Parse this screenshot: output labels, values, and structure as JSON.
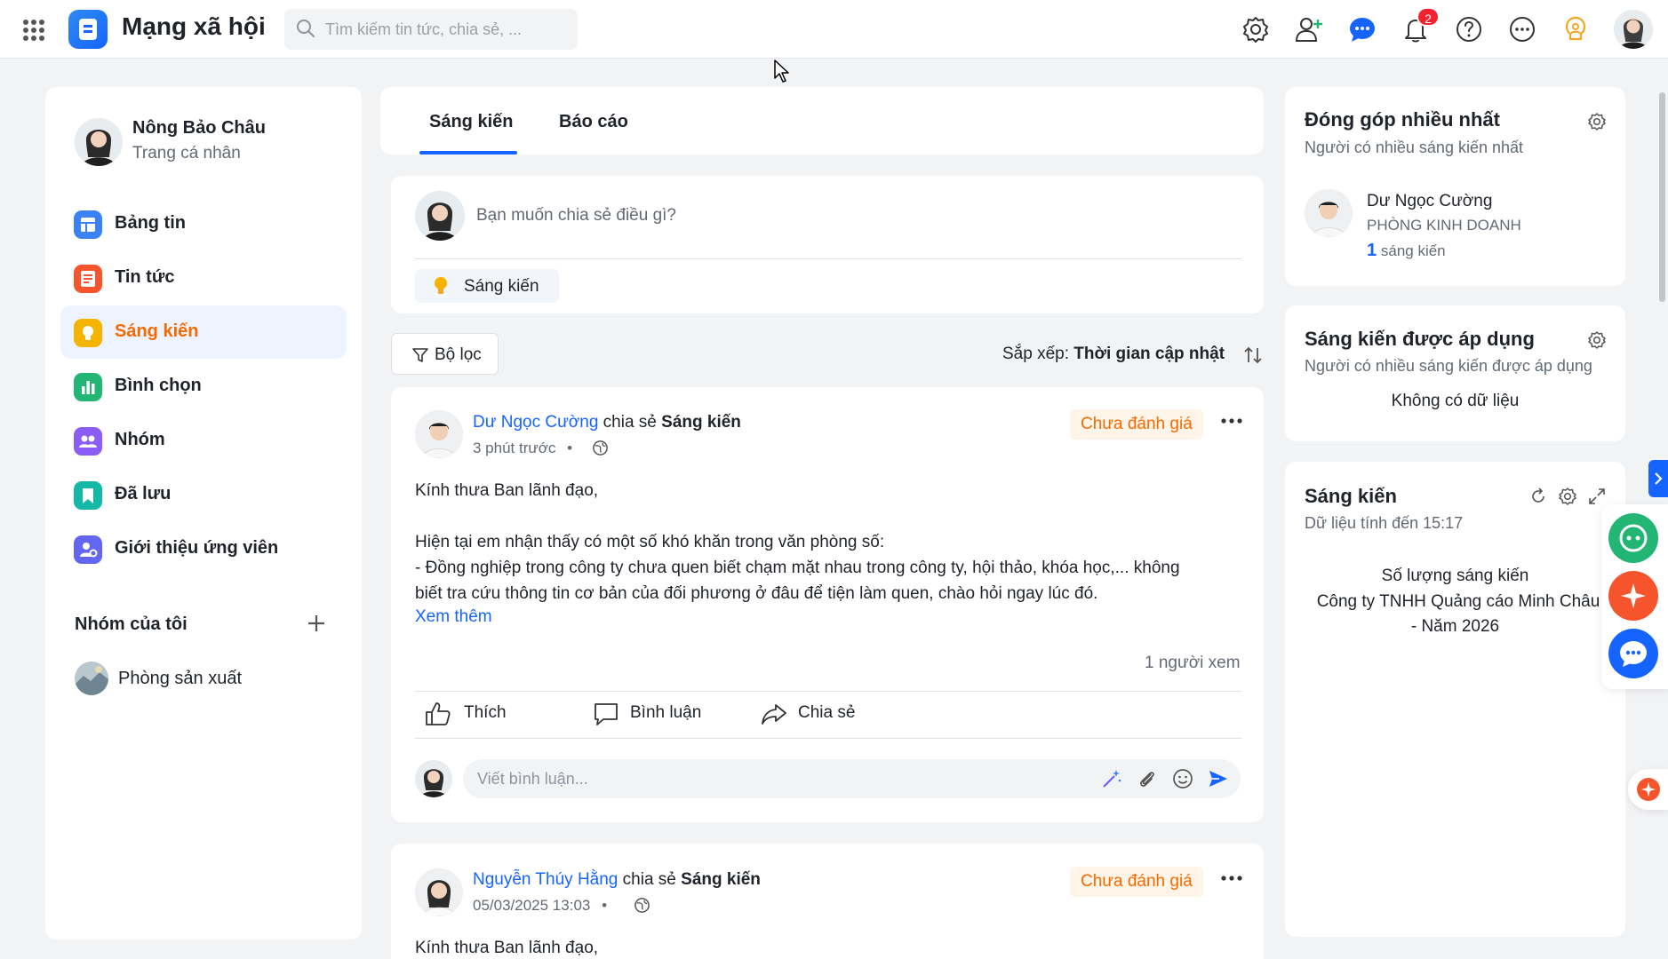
{
  "header": {
    "app_title": "Mạng xã hội",
    "search_placeholder": "Tìm kiếm tin tức, chia sẻ, ...",
    "notification_count": "2"
  },
  "sidebar": {
    "profile_name": "Nông Bảo Châu",
    "profile_sub": "Trang cá nhân",
    "items": [
      {
        "label": "Bảng tin",
        "color": "#3b82f6"
      },
      {
        "label": "Tin tức",
        "color": "#f5542d"
      },
      {
        "label": "Sáng kiến",
        "color": "#f5b400"
      },
      {
        "label": "Bình chọn",
        "color": "#22b573"
      },
      {
        "label": "Nhóm",
        "color": "#8b5cf6"
      },
      {
        "label": "Đã lưu",
        "color": "#14b8a6"
      },
      {
        "label": "Giới thiệu ứng viên",
        "color": "#6366f1"
      }
    ],
    "group_title": "Nhóm của tôi",
    "groups": [
      {
        "label": "Phòng sản xuất"
      }
    ]
  },
  "main": {
    "tabs": [
      {
        "label": "Sáng kiến"
      },
      {
        "label": "Báo cáo"
      }
    ],
    "composer_placeholder": "Bạn muốn chia sẻ điều gì?",
    "composer_chip": "Sáng kiến",
    "filter_label": "Bộ lọc",
    "sort_prefix": "Sắp xếp:",
    "sort_value": "Thời gian cập nhật",
    "posts": [
      {
        "author": "Dư Ngọc Cường",
        "verb": "chia sẻ",
        "type": "Sáng kiến",
        "time": "3 phút trước",
        "status": "Chưa đánh giá",
        "body_lines": [
          "Kính thưa Ban lãnh đạo,",
          "",
          "Hiện tại em nhận thấy có một số khó khăn trong văn phòng số:",
          "- Đồng nghiệp trong công ty chưa quen biết chạm mặt nhau trong công ty, hội thảo, khóa học,... không",
          "biết tra cứu thông tin cơ bản của đối phương ở đâu để tiện làm quen, chào hỏi ngay lúc đó."
        ],
        "see_more": "Xem thêm",
        "views": "1 người xem",
        "actions": [
          "Thích",
          "Bình luận",
          "Chia sẻ"
        ],
        "comment_placeholder": "Viết bình luận..."
      },
      {
        "author": "Nguyễn Thúy Hằng",
        "verb": "chia sẻ",
        "type": "Sáng kiến",
        "time": "05/03/2025 13:03",
        "status": "Chưa đánh giá",
        "body_first": "Kính thưa Ban lãnh đạo,"
      }
    ]
  },
  "right": {
    "top": {
      "title": "Đóng góp nhiều nhất",
      "subtitle": "Người có nhiều sáng kiến nhất",
      "person_name": "Dư Ngọc Cường",
      "person_dept": "PHÒNG KINH DOANH",
      "count": "1",
      "count_label": "sáng kiến"
    },
    "applied": {
      "title": "Sáng kiến được áp dụng",
      "subtitle": "Người có nhiều sáng kiến được áp dụng",
      "empty": "Không có dữ liệu"
    },
    "stats": {
      "title": "Sáng kiến",
      "subtitle": "Dữ liệu tính đến 15:17",
      "line1": "Số lượng sáng kiến",
      "line2": "Công ty TNHH Quảng cáo Minh Châu",
      "line3": "- Năm 2026"
    }
  }
}
